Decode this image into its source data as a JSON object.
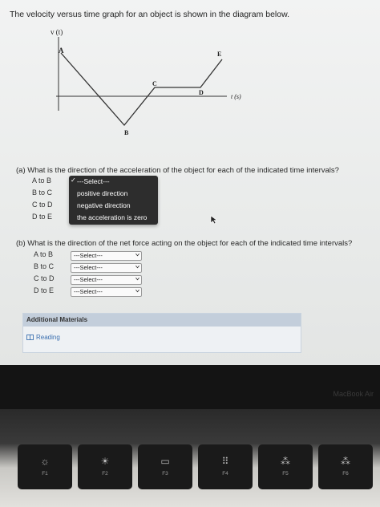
{
  "intro": "The velocity versus time graph for an object is shown in the diagram below.",
  "graph": {
    "y_axis_label": "v (t)",
    "x_axis_label": "t (s)",
    "points": [
      "A",
      "B",
      "C",
      "D",
      "E"
    ]
  },
  "part_a": {
    "question": "(a)  What is the direction of the acceleration of the object for each of the indicated time intervals?",
    "rows": [
      "A to B",
      "B to C",
      "C to D",
      "D to E"
    ],
    "dropdown_options": [
      "---Select---",
      "positive direction",
      "negative direction",
      "the acceleration is zero"
    ],
    "selected_option": "---Select---"
  },
  "part_b": {
    "question": "(b)  What is the direction of the net force acting on the object for each of the indicated time intervals?",
    "rows": [
      "A to B",
      "B to C",
      "C to D",
      "D to E"
    ],
    "selects": [
      "---Select---",
      "---Select---",
      "---Select---",
      "---Select---"
    ]
  },
  "additional": {
    "title": "Additional Materials",
    "link": "Reading"
  },
  "laptop": {
    "brand": "MacBook Air",
    "fkeys": [
      {
        "label": "F1",
        "icon": "brightness-down-icon",
        "glyph": "☼"
      },
      {
        "label": "F2",
        "icon": "brightness-up-icon",
        "glyph": "☀"
      },
      {
        "label": "F3",
        "icon": "mission-control-icon",
        "glyph": "▭"
      },
      {
        "label": "F4",
        "icon": "launchpad-icon",
        "glyph": "⠿"
      },
      {
        "label": "F5",
        "icon": "keyboard-light-down-icon",
        "glyph": "⁂"
      },
      {
        "label": "F6",
        "icon": "keyboard-light-up-icon",
        "glyph": "⁂"
      }
    ]
  }
}
